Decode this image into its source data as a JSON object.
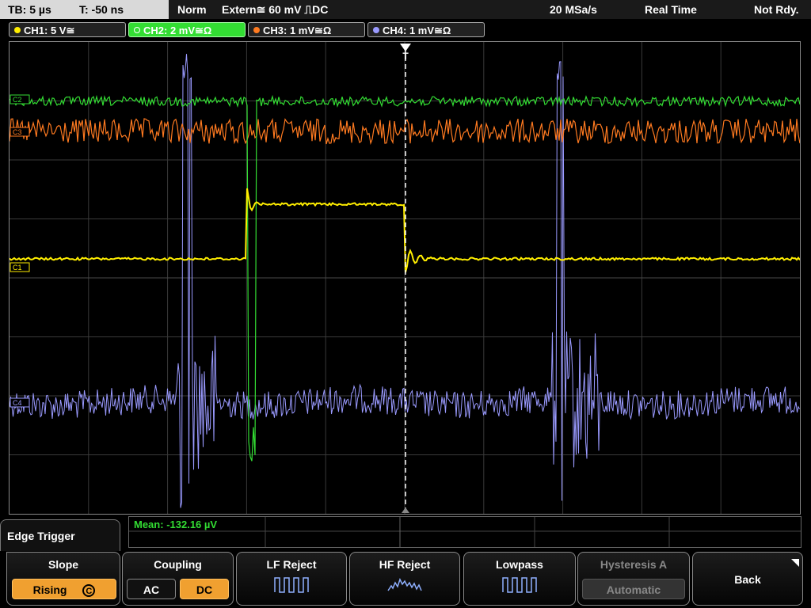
{
  "status_bar": {
    "timebase": "TB: 5 µs",
    "trigger_offset": "T: -50 ns",
    "mode": "Norm",
    "trigger_source": "Extern",
    "trigger_level": "60 mV",
    "trigger_coupling": "DC",
    "sample_rate": "20 MSa/s",
    "acq_mode": "Real Time",
    "state": "Not Rdy."
  },
  "channels": [
    {
      "label": "CH1: 5 V",
      "color": "#ffee00"
    },
    {
      "label": "CH2: 2 mV",
      "color": "#33dd33"
    },
    {
      "label": "CH3: 1 mV",
      "color": "#ff7a20"
    },
    {
      "label": "CH4: 1 mV",
      "color": "#9a9aff"
    }
  ],
  "markers": {
    "ch1": "C1",
    "ch2": "C2",
    "ch3": "C3",
    "ch4": "C4",
    "trigger": "T"
  },
  "measurement": {
    "label": "Mean:",
    "value": "-132.16 µV",
    "color": "#33dd33"
  },
  "menu": {
    "title": "Edge Trigger",
    "slope": {
      "title": "Slope",
      "value": "Rising",
      "extra": "C"
    },
    "coupling": {
      "title": "Coupling",
      "options": [
        "AC",
        "DC"
      ],
      "selected": "DC"
    },
    "lf_reject": {
      "title": "LF Reject"
    },
    "hf_reject": {
      "title": "HF Reject"
    },
    "lowpass": {
      "title": "Lowpass"
    },
    "hysteresis": {
      "title": "Hysteresis A",
      "value": "Automatic"
    },
    "back": {
      "title": "Back"
    }
  }
}
